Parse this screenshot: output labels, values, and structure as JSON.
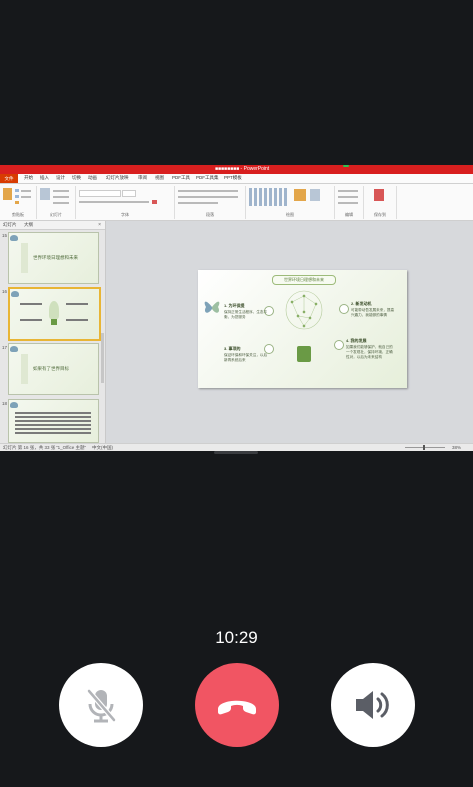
{
  "call": {
    "duration": "10:29",
    "buttons": {
      "mute": "mic-muted-icon",
      "hangup": "hang-up-icon",
      "speaker": "speaker-icon"
    },
    "colors": {
      "background": "#16181b",
      "hangup": "#f15563",
      "button": "#ffffff"
    }
  },
  "ppt": {
    "window_title": "■■■■■■■■ - PowerPoint",
    "tabs": [
      "文件",
      "开始",
      "插入",
      "设计",
      "切换",
      "动画",
      "幻灯片放映",
      "审阅",
      "视图",
      "PDF工具",
      "PDF工具集",
      "PPT模板"
    ],
    "ribbon_groups": [
      "剪贴板",
      "幻灯片",
      "字体",
      "段落",
      "绘图",
      "编辑",
      "保存到"
    ],
    "panel_tabs": [
      "幻灯片",
      "大纲"
    ],
    "slide_numbers": [
      "15",
      "16",
      "17",
      "18"
    ],
    "thumbnails": [
      {
        "title": "世界环境日理想和未来"
      },
      {
        "title": ""
      },
      {
        "title": "如果有了世界目标"
      },
      {
        "title": ""
      }
    ],
    "slide": {
      "title": "世界环境日理想和未来",
      "items": [
        {
          "heading": "1. 为环保提",
          "body": "保持正常生活程序，生态平衡，为您服务"
        },
        {
          "heading": "2. 新发动机",
          "body": "可能带动吾发展未来，提高兴趣力，我能够的事情"
        },
        {
          "heading": "3. 事项的",
          "body": "保证环保和环保关注，以后新再系统后来"
        },
        {
          "heading": "4. 我的发展",
          "body": "如果我们能够保护，就自己的一个发现社，保持环境，正确性对，以后为未来结构"
        }
      ]
    },
    "status": {
      "left": "幻灯片 第 16 张，共 33 张",
      "theme": "\"1_Office 主题\"",
      "lang": "中文(中国)",
      "zoom": "38%"
    },
    "colors": {
      "title_bar": "#d81f1f",
      "file_tab": "#d83b01",
      "accent_green": "#6a9a45"
    }
  }
}
